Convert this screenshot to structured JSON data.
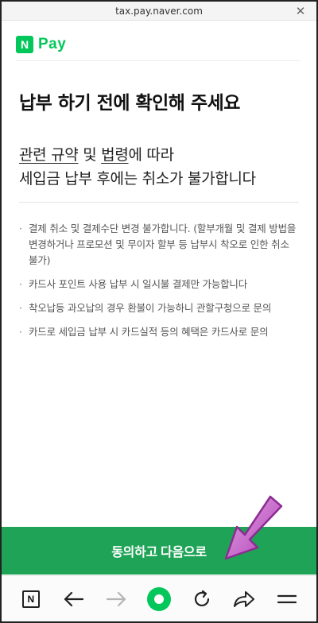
{
  "browser": {
    "url": "tax.pay.naver.com",
    "close_glyph": "✕"
  },
  "brand": {
    "badge": "N",
    "name": "Pay",
    "color": "#03c75a"
  },
  "page": {
    "title": "납부 하기 전에 확인해 주세요",
    "sub_link_1": "관련 규약",
    "sub_and": " 및 ",
    "sub_link_2": "법령",
    "sub_line1_rest": "에 따라",
    "sub_line2": "세입금 납부 후에는 취소가 불가합니다"
  },
  "notes": [
    "결제 취소 및 결제수단 변경 불가합니다. (할부개월 및 결제 방법을 변경하거나 프로모션 및 무이자 할부 등 납부시 착오로 인한 취소 불가)",
    "카드사 포인트 사용 납부 시 일시불 결제만 가능합니다",
    "착오납등 과오납의 경우 환불이 가능하니 관할구청으로 문의",
    "카드로 세입금 납부 시 카드실적 등의 혜택은 카드사로 문의"
  ],
  "agree_button": {
    "label": "동의하고 다음으로",
    "color": "#1fa356"
  },
  "navbar": {
    "home_badge": "N",
    "accent": "#03c75a",
    "icons": [
      "naver-home-icon",
      "back-arrow-icon",
      "forward-arrow-icon",
      "green-dot-icon",
      "refresh-icon",
      "share-icon",
      "menu-icon"
    ]
  },
  "annotation": {
    "color": "#c452c7"
  }
}
